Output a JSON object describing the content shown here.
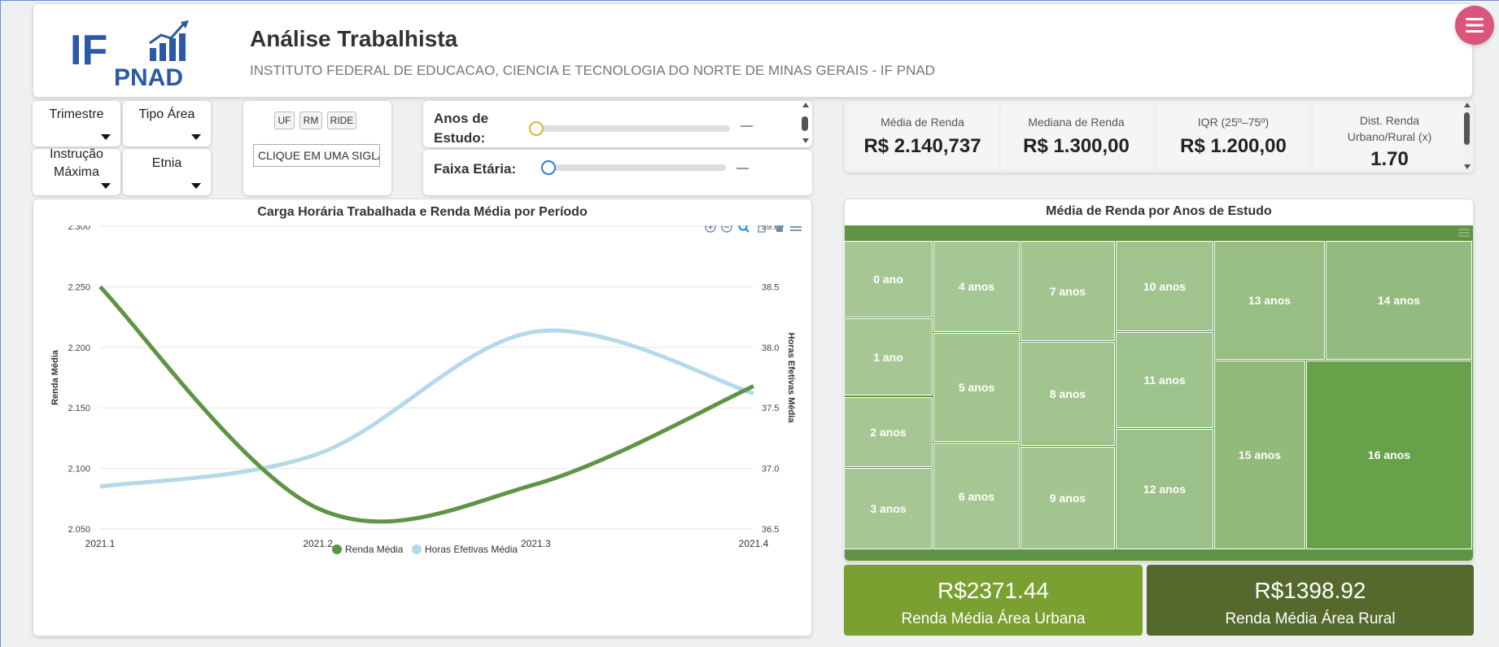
{
  "header": {
    "logo_text_top": "IF",
    "logo_text_bottom": "PNAD",
    "title": "Análise Trabalhista",
    "subtitle": "INSTITUTO FEDERAL DE EDUCACAO, CIENCIA E TECNOLOGIA DO NORTE DE MINAS GERAIS - IF PNAD",
    "menu_icon": "hamburger-menu-icon"
  },
  "filters": {
    "trimestre": "Trimestre",
    "tipo_area": "Tipo Área",
    "instrucao_line1": "Instrução",
    "instrucao_line2": "Máxima",
    "etnia": "Etnia"
  },
  "sigla": {
    "buttons": [
      "UF",
      "RM",
      "RIDE"
    ],
    "input_value": "CLIQUE EM UMA SIGLA"
  },
  "sliders": {
    "anos_line1": "Anos de",
    "anos_line2": "Estudo:",
    "anos_value": "—",
    "faixa_label": "Faixa Etária:",
    "faixa_value": "—"
  },
  "kpis": [
    {
      "label": "Média de Renda",
      "value": "R$ 2.140,737"
    },
    {
      "label": "Mediana de Renda",
      "value": "R$ 1.300,00"
    },
    {
      "label": "IQR (25º–75º)",
      "value": "R$ 1.200,00"
    },
    {
      "label_line1": "Dist. Renda",
      "label_line2": "Urbano/Rural (x)",
      "value": "1.70"
    }
  ],
  "colors": {
    "renda_line": "#5e9444",
    "horas_line": "#b4d9e8",
    "urban_card": "#79a030",
    "rural_card": "#56692c",
    "menu_button": "#d9567a"
  },
  "chart_data": {
    "type": "line",
    "title": "Carga Horária Trabalhada e Renda Média por Período",
    "x": [
      "2021.1",
      "2021.2",
      "2021.3",
      "2021.4"
    ],
    "series": [
      {
        "name": "Renda Média",
        "axis": "left",
        "values": [
          2.25,
          2.067,
          2.087,
          2.168
        ]
      },
      {
        "name": "Horas Efetivas Média",
        "axis": "right",
        "values": [
          36.85,
          37.12,
          38.13,
          37.62
        ]
      }
    ],
    "ylabel": "Renda Média",
    "ylabel_right": "Horas Efetivas Média",
    "ylim": [
      2.05,
      2.3
    ],
    "yticks": [
      "2.300",
      "2.250",
      "2.200",
      "2.150",
      "2.100",
      "2.050"
    ],
    "ylim_right": [
      36.5,
      39.0
    ],
    "yticks_right": [
      "39.0",
      "38.5",
      "38.0",
      "37.5",
      "37.0",
      "36.5"
    ],
    "grid": true,
    "legend": "bottom-center",
    "toolbar_icons": [
      "zoom-in-icon",
      "zoom-out-icon",
      "zoom-selection-icon",
      "pan-icon",
      "home-icon",
      "menu-icon"
    ]
  },
  "treemap": {
    "title": "Média de Renda por Anos de Estudo",
    "tiles": [
      {
        "label": "0 ano",
        "color": "#a6c794"
      },
      {
        "label": "1 ano",
        "color": "#a6c794"
      },
      {
        "label": "2 anos",
        "color": "#a6c794"
      },
      {
        "label": "3 anos",
        "color": "#a6c794"
      },
      {
        "label": "4 anos",
        "color": "#a5c793"
      },
      {
        "label": "5 anos",
        "color": "#a3c590"
      },
      {
        "label": "6 anos",
        "color": "#a5c793"
      },
      {
        "label": "7 anos",
        "color": "#a3c590"
      },
      {
        "label": "8 anos",
        "color": "#a1c48e"
      },
      {
        "label": "9 anos",
        "color": "#a3c590"
      },
      {
        "label": "10 anos",
        "color": "#a1c48e"
      },
      {
        "label": "11 anos",
        "color": "#9fc38c"
      },
      {
        "label": "12 anos",
        "color": "#9cc089"
      },
      {
        "label": "13 anos",
        "color": "#98be84"
      },
      {
        "label": "14 anos",
        "color": "#94bb7f"
      },
      {
        "label": "15 anos",
        "color": "#93ba7d"
      },
      {
        "label": "16 anos",
        "color": "#67a24b"
      }
    ]
  },
  "urbano": {
    "value": "R$2371.44",
    "label": "Renda Média Área Urbana"
  },
  "rural": {
    "value": "R$1398.92",
    "label": "Renda Média Área Rural"
  }
}
